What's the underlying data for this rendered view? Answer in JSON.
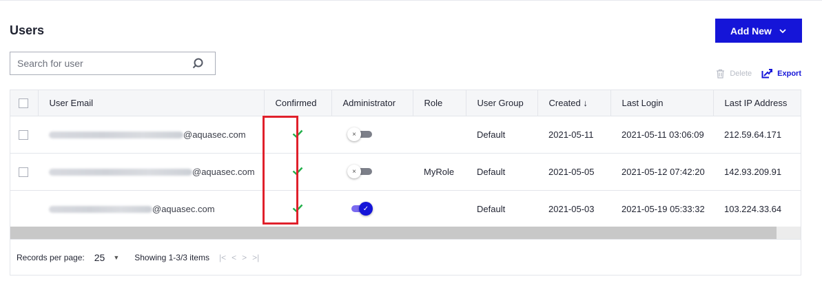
{
  "page": {
    "title": "Users"
  },
  "toolbar": {
    "add_new_label": "Add New",
    "delete_label": "Delete",
    "export_label": "Export"
  },
  "search": {
    "placeholder": "Search for user",
    "value": ""
  },
  "table": {
    "columns": [
      "User Email",
      "Confirmed",
      "Administrator",
      "Role",
      "User Group",
      "Created",
      "Last Login",
      "Last IP Address"
    ],
    "sort_indicator": "↓",
    "rows": [
      {
        "email_domain": "@aquasec.com",
        "confirmed": true,
        "administrator": false,
        "role": "",
        "user_group": "Default",
        "created": "2021-05-11",
        "last_login": "2021-05-11 03:06:09",
        "last_ip": "212.59.64.171"
      },
      {
        "email_domain": "@aquasec.com",
        "confirmed": true,
        "administrator": false,
        "role": "MyRole",
        "user_group": "Default",
        "created": "2021-05-05",
        "last_login": "2021-05-12 07:42:20",
        "last_ip": "142.93.209.91"
      },
      {
        "email_domain": "@aquasec.com",
        "confirmed": true,
        "administrator": true,
        "role": "",
        "user_group": "Default",
        "created": "2021-05-03",
        "last_login": "2021-05-19 05:33:32",
        "last_ip": "103.224.33.64"
      }
    ]
  },
  "pagination": {
    "records_per_page_label": "Records per page:",
    "records_per_page_value": "25",
    "showing_text": "Showing 1-3/3 items"
  },
  "colors": {
    "accent": "#1515d8",
    "success": "#22b04b",
    "highlight": "#e0202b"
  },
  "icons": {
    "search": "search-icon",
    "dropdown": "chevron-down-icon",
    "delete": "trash-icon",
    "export": "export-icon",
    "check": "check-icon"
  }
}
